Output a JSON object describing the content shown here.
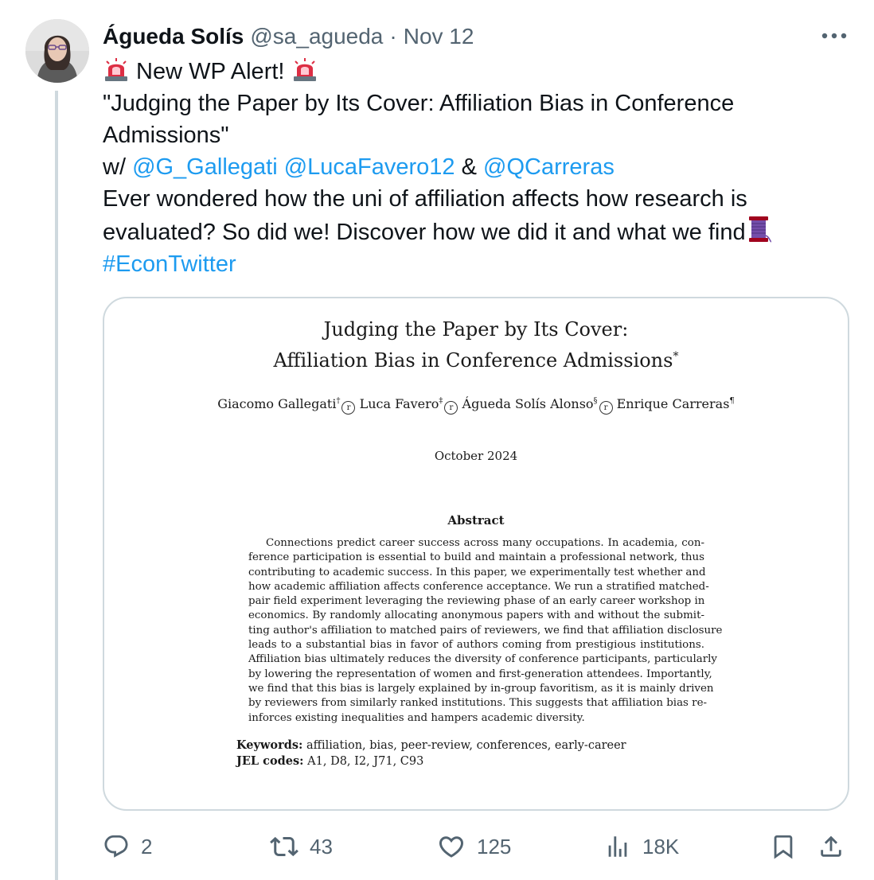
{
  "author": {
    "name": "Águeda Solís",
    "handle": "@sa_agueda",
    "separator": "·",
    "date": "Nov 12"
  },
  "tweet": {
    "line1_text": " New WP Alert! ",
    "line2": "\"Judging the Paper by Its Cover: Affiliation Bias in Conference",
    "line3": "Admissions\"",
    "with_prefix": "w/ ",
    "mention1": "@G_Gallegati",
    "mention2": "@LucaFavero12",
    "amp": " & ",
    "mention3": "@QCarreras",
    "line5": "Ever wondered how the uni of affiliation affects how research is",
    "line6": "evaluated? So did we! Discover how we did it and what we find",
    "hashtag": "#EconTwitter"
  },
  "paper": {
    "title_line1": "Judging the Paper by Its Cover:",
    "title_line2": "Affiliation Bias in Conference Admissions",
    "title_mark": "*",
    "author1": "Giacomo Gallegati",
    "author1_mark": "†",
    "author2": "Luca Favero",
    "author2_mark": "‡",
    "author3": "Águeda Solís Alonso",
    "author3_mark": "§",
    "author4": "Enrique Carreras",
    "author4_mark": "¶",
    "orcid_glyph": "r",
    "date": "October 2024",
    "abstract_heading": "Abstract",
    "abstract_lines": [
      "Connections predict career success across many occupations. In academia, con-",
      "ference participation is essential to build and maintain a professional network, thus",
      "contributing to academic success. In this paper, we experimentally test whether and",
      "how academic affiliation affects conference acceptance. We run a stratified matched-",
      "pair field experiment leveraging the reviewing phase of an early career workshop in",
      "economics. By randomly allocating anonymous papers with and without the submit-",
      "ting author's affiliation to matched pairs of reviewers, we find that affiliation disclosure",
      "leads to a substantial bias in favor of authors coming from prestigious institutions.",
      "Affiliation bias ultimately reduces the diversity of conference participants, particularly",
      "by lowering the representation of women and first-generation attendees. Importantly,",
      "we find that this bias is largely explained by in-group favoritism, as it is mainly driven",
      "by reviewers from similarly ranked institutions. This suggests that affiliation bias re-",
      "inforces existing inequalities and hampers academic diversity."
    ],
    "keywords_label": "Keywords:",
    "keywords": " affiliation, bias, peer-review, conferences, early-career",
    "jel_label": "JEL codes:",
    "jel": " A1, D8, I2, J71, C93"
  },
  "actions": {
    "replies": "2",
    "reposts": "43",
    "likes": "125",
    "views": "18K"
  },
  "colors": {
    "link": "#1d9bf0",
    "muted": "#536471",
    "border": "#cfd9de"
  }
}
